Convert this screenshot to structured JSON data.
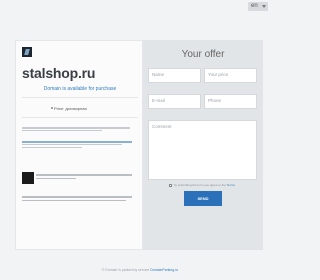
{
  "language": {
    "selected": "en"
  },
  "listing": {
    "domain": "stalshop.ru",
    "availability": "Domain is available for purchase",
    "price_label": "Price: договорная"
  },
  "offer_form": {
    "title": "Your offer",
    "name_placeholder": "Name",
    "price_placeholder": "Your price",
    "email_placeholder": "E-mail",
    "phone_placeholder": "Phone",
    "comment_placeholder": "Comment",
    "terms_prefix": "by submitting the form you agree to the",
    "terms_link": "Terms",
    "submit_label": "SEND"
  },
  "footer": {
    "prefix": "© Domain is parked by service",
    "link": "DomainParking.ru"
  }
}
